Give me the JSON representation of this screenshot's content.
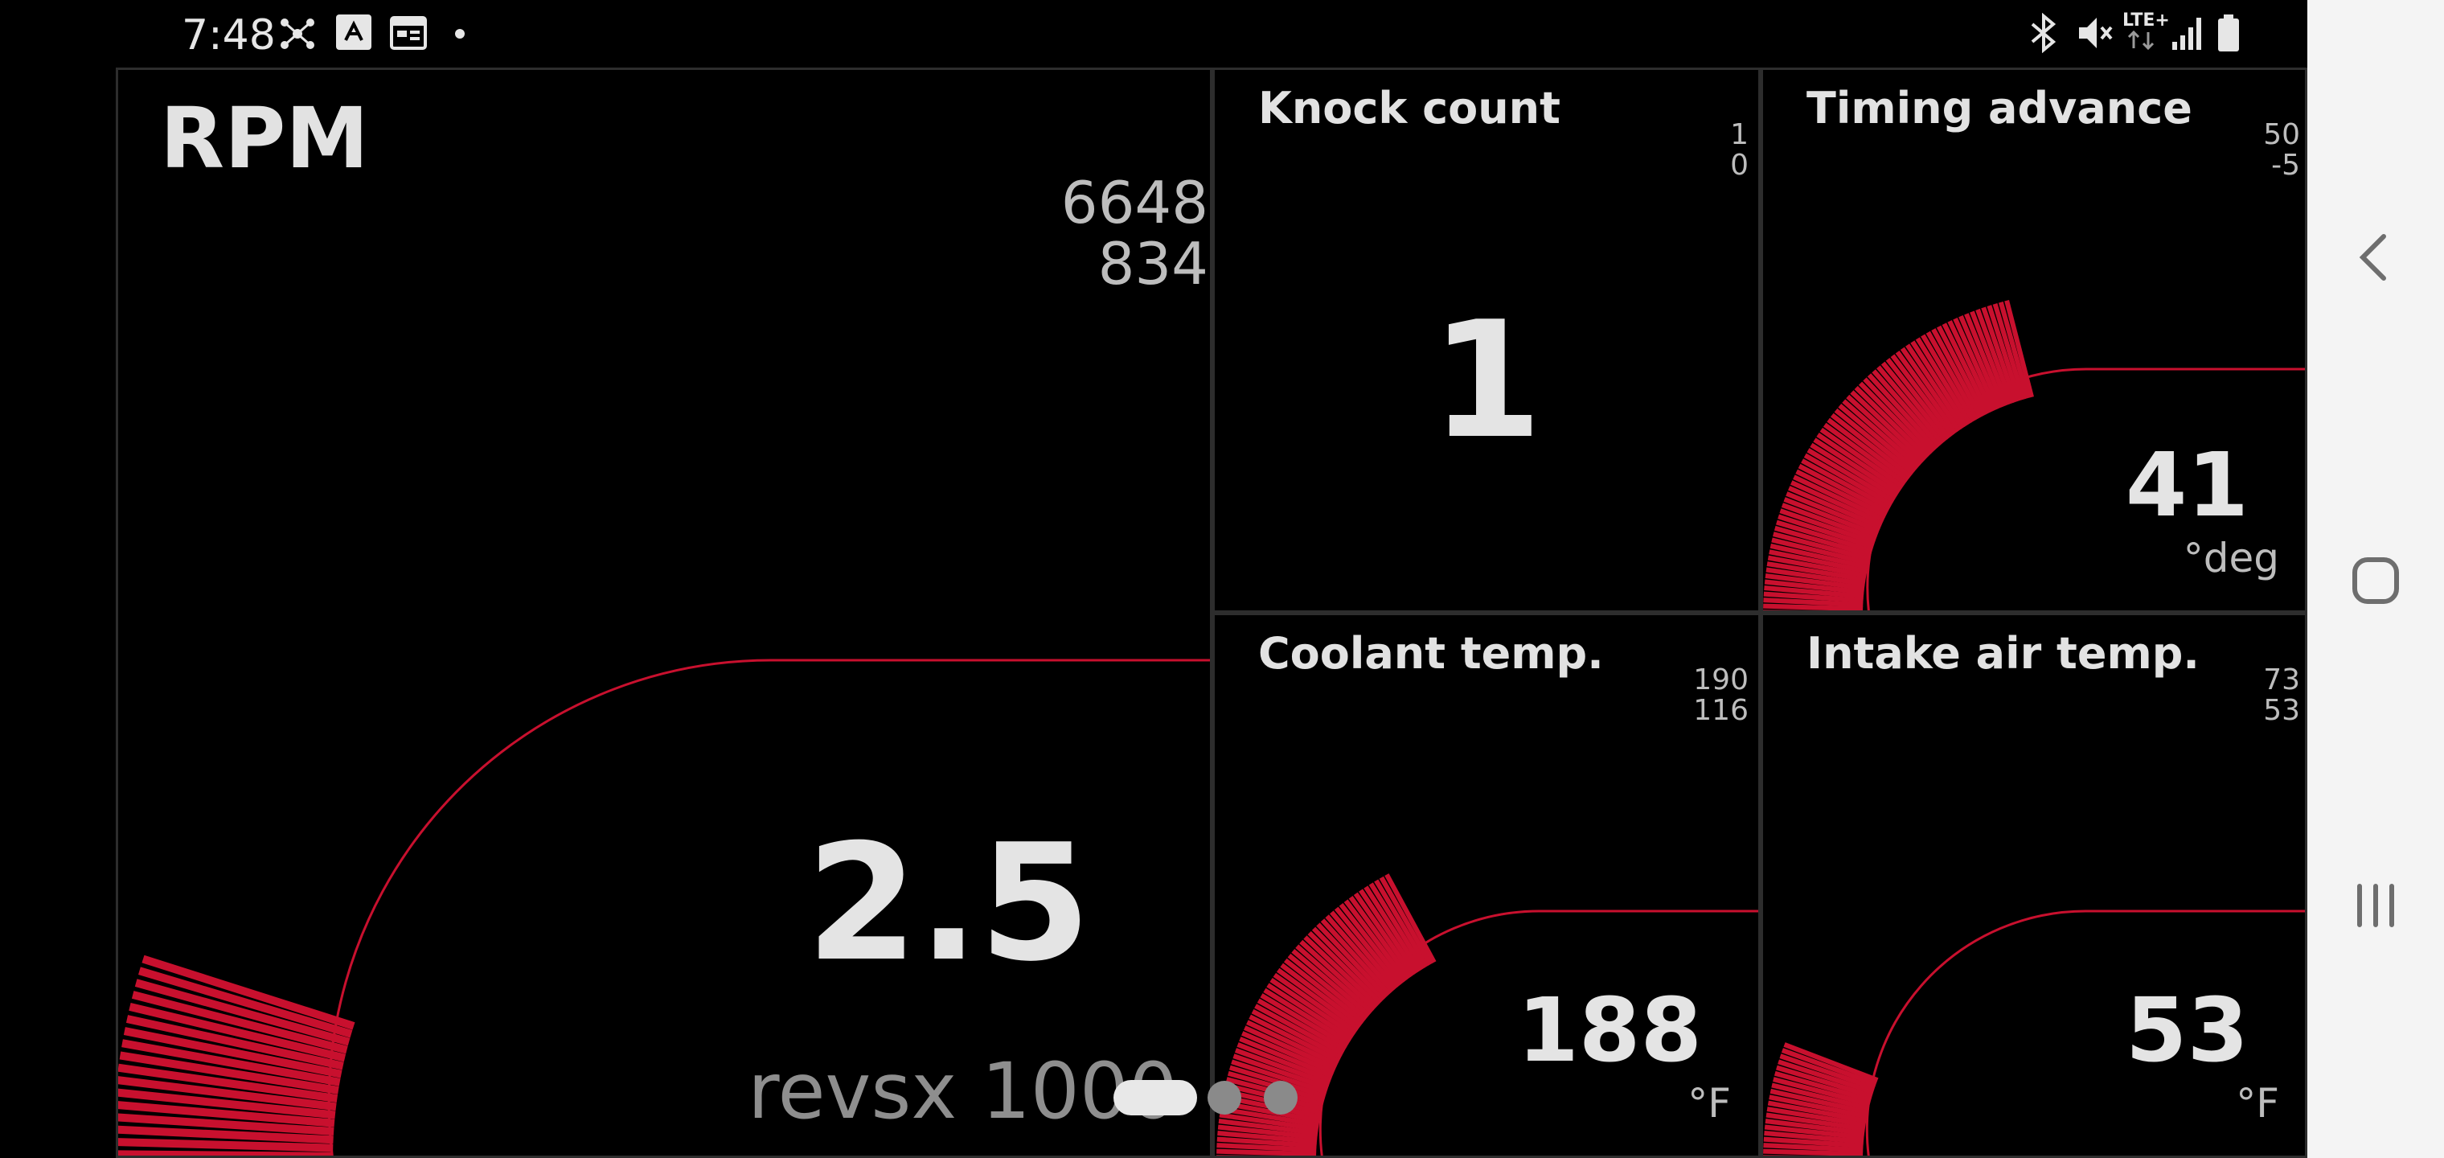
{
  "status_bar": {
    "time": "7:48",
    "network_label": "LTE+",
    "icons_left": [
      "network-hub-icon",
      "app-icon",
      "calendar-icon",
      "notification-dot-icon"
    ],
    "icons_right": [
      "bluetooth-icon",
      "mute-icon",
      "lte-data-icon",
      "signal-icon",
      "battery-icon"
    ]
  },
  "gauges": {
    "rpm": {
      "title": "RPM",
      "max": "6648",
      "min": "834",
      "value": "2.5",
      "unit": "revsx 1000",
      "fill_fraction": 0.2
    },
    "knock": {
      "title": "Knock count",
      "max": "1",
      "min": "0",
      "value": "1"
    },
    "timing": {
      "title": "Timing advance",
      "max": "50",
      "min": "-5",
      "value": "41",
      "unit": "°deg",
      "fill_fraction": 0.84
    },
    "coolant": {
      "title": "Coolant temp.",
      "max": "190",
      "min": "116",
      "value": "188",
      "unit": "°F",
      "fill_fraction": 0.69
    },
    "intake": {
      "title": "Intake air temp.",
      "max": "73",
      "min": "53",
      "value": "53",
      "unit": "°F",
      "fill_fraction": 0.24
    }
  },
  "pager": {
    "pages": 3,
    "active": 0
  },
  "nav_bar": {
    "icons": [
      "back-icon",
      "home-icon",
      "recents-icon"
    ]
  },
  "colors": {
    "accent": "#c8102e",
    "text": "#e0e0e0",
    "border": "#2d2d2d",
    "navbar": "#f4f4f4"
  }
}
